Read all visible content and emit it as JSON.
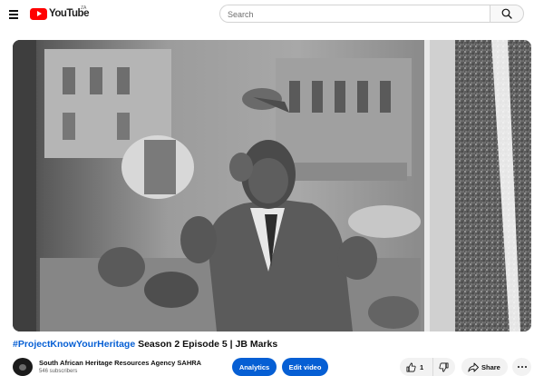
{
  "header": {
    "logo_text": "YouTube",
    "country_code": "ZA",
    "search_placeholder": "Search"
  },
  "video": {
    "title_hashtag": "#ProjectKnowYourHeritage",
    "title_rest": " Season 2 Episode 5 | JB Marks"
  },
  "channel": {
    "name": "South African Heritage Resources Agency SAHRA",
    "subscribers": "546 subscribers"
  },
  "actions": {
    "analytics_label": "Analytics",
    "edit_label": "Edit video",
    "like_count": "1",
    "share_label": "Share"
  },
  "colors": {
    "accent": "#065fd4",
    "brand": "#ff0000"
  }
}
